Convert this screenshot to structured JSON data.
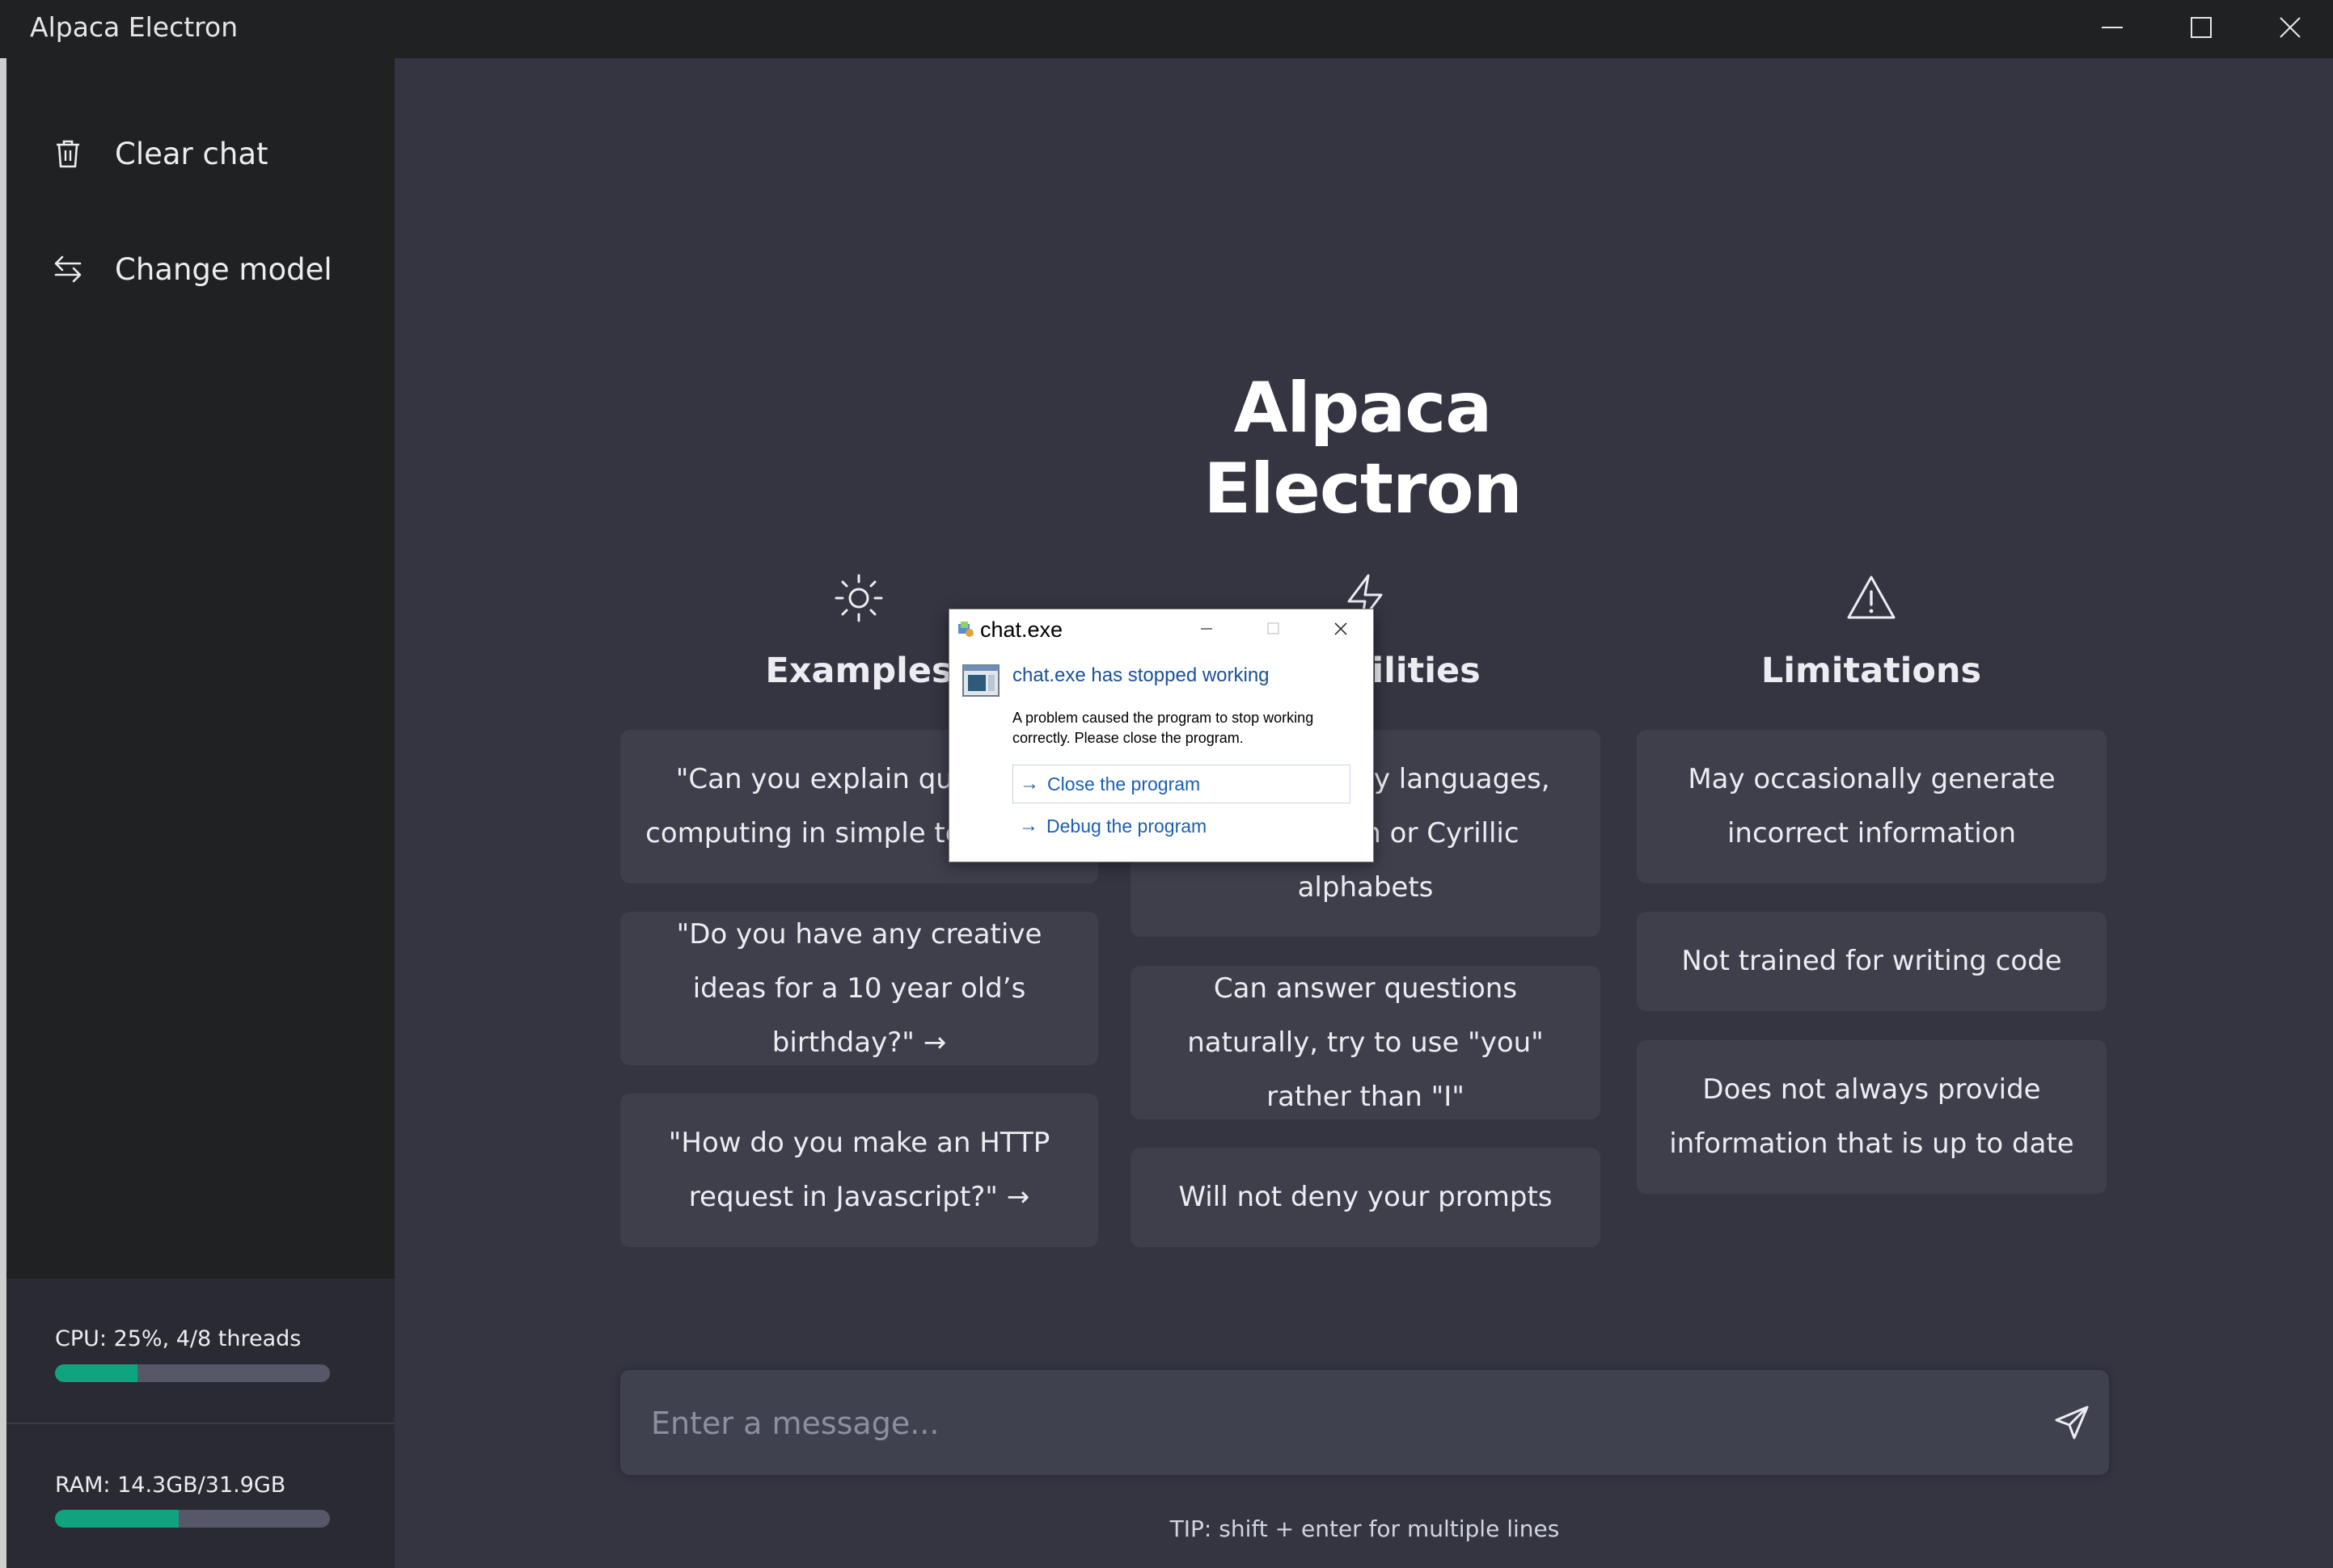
{
  "window": {
    "title": "Alpaca Electron"
  },
  "sidebar": {
    "items": [
      {
        "label": "Clear chat",
        "icon": "trash-icon"
      },
      {
        "label": "Change model",
        "icon": "swap-arrows-icon"
      }
    ],
    "cpu": {
      "label": "CPU: 25%, 4/8 threads",
      "usage": 0.3
    },
    "ram": {
      "label": "RAM: 14.3GB/31.9GB",
      "usage": 0.45
    }
  },
  "main": {
    "title": "Alpaca Electron",
    "columns": [
      {
        "title": "Examples",
        "icon": "sun-icon",
        "cards": [
          "\"Can you explain quantum computing in simple terms?\" →",
          "\"Do you have any creative ideas for a 10 year old’s birthday?\" →",
          "\"How do you make an HTTP request in Javascript?\" →"
        ]
      },
      {
        "title": "Capabilities",
        "icon": "lightning-icon",
        "cards": [
          "Supports many languages, mostly Latin or Cyrillic alphabets",
          "Can answer questions naturally, try to use \"you\" rather than \"I\"",
          "Will not deny your prompts"
        ]
      },
      {
        "title": "Limitations",
        "icon": "warning-icon",
        "cards": [
          "May occasionally generate incorrect information",
          "Not trained for writing code",
          "Does not always provide information that is up to date"
        ]
      }
    ],
    "input": {
      "placeholder": "Enter a message...",
      "value": ""
    },
    "tip": "TIP: shift + enter for multiple lines"
  },
  "dialog": {
    "title": "chat.exe",
    "heading": "chat.exe has stopped working",
    "body": "A problem caused the program to stop working correctly. Please close the program.",
    "actions": [
      {
        "label": "Close the program"
      },
      {
        "label": "Debug the program"
      }
    ]
  },
  "colors": {
    "background": "#343541",
    "sidebar": "#202123",
    "card": "#3e3f4b",
    "accent": "#10a37f",
    "dialog_heading": "#1a4f9c"
  }
}
